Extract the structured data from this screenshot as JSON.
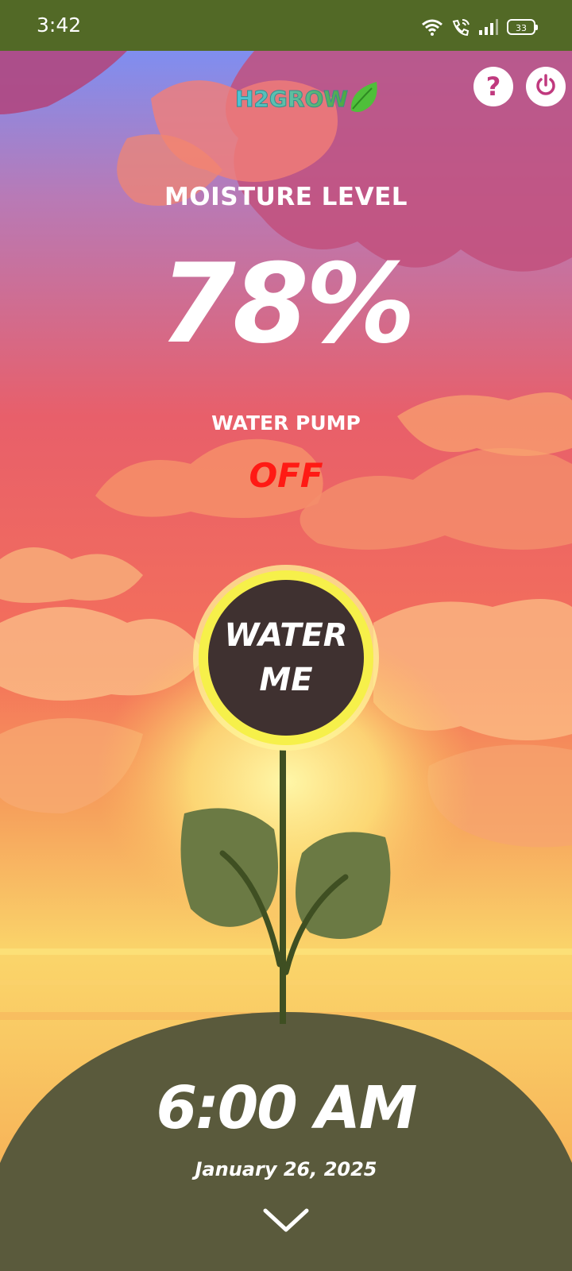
{
  "status_bar": {
    "time": "3:42",
    "battery": "33",
    "icons": [
      "wifi-icon",
      "wifi-call-icon",
      "signal-icon",
      "battery-icon"
    ]
  },
  "header": {
    "logo_text": "H2GROW",
    "help_label": "?",
    "icons": [
      "help-icon",
      "power-icon",
      "leaf-icon"
    ]
  },
  "moisture": {
    "label": "MOISTURE LEVEL",
    "value": "78%"
  },
  "pump": {
    "label": "WATER PUMP",
    "state": "OFF",
    "state_color": "#ff1a14"
  },
  "water_button": {
    "line1": "WATER",
    "line2": "ME"
  },
  "clock": {
    "time": "6:00 AM",
    "date": "January 26, 2025"
  },
  "colors": {
    "status_bar": "#526926",
    "hill": "#5a5a3c",
    "leaf": "#6b7a44",
    "stem": "#3f4f22",
    "button_fill": "#3f3130",
    "button_glow": "#f6f04a"
  }
}
